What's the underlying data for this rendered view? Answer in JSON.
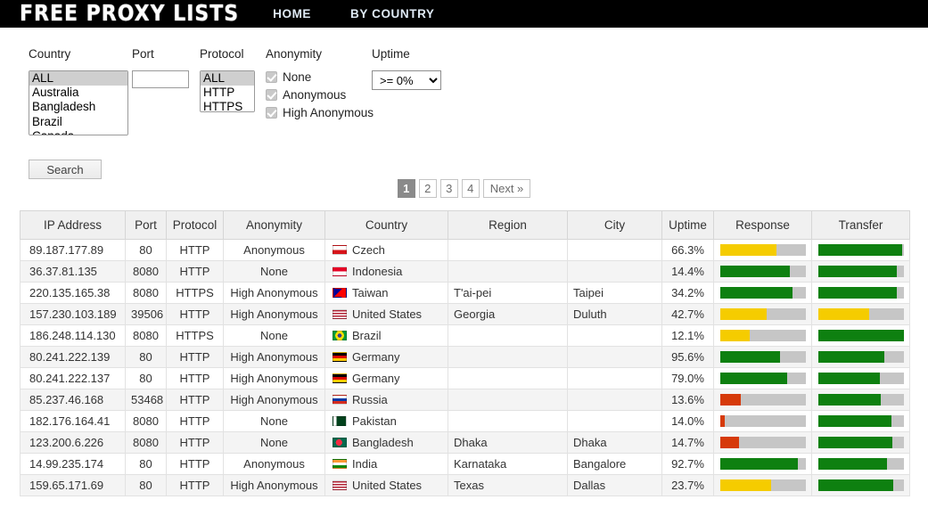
{
  "header": {
    "logo": "FREE PROXY LISTS",
    "nav": [
      {
        "label": "HOME"
      },
      {
        "label": "BY COUNTRY"
      }
    ]
  },
  "filters": {
    "country": {
      "label": "Country",
      "selected": "ALL",
      "options": [
        "ALL",
        "Australia",
        "Bangladesh",
        "Brazil",
        "Canada"
      ]
    },
    "port": {
      "label": "Port",
      "value": "",
      "placeholder": ""
    },
    "protocol": {
      "label": "Protocol",
      "selected": "ALL",
      "options": [
        "ALL",
        "HTTP",
        "HTTPS"
      ]
    },
    "anonymity": {
      "label": "Anonymity",
      "items": [
        {
          "label": "None",
          "checked": true
        },
        {
          "label": "Anonymous",
          "checked": true
        },
        {
          "label": "High Anonymous",
          "checked": true
        }
      ]
    },
    "uptime": {
      "label": "Uptime",
      "selected": ">= 0%",
      "options": [
        ">= 0%"
      ]
    },
    "search_label": "Search"
  },
  "pagination": {
    "pages": [
      "1",
      "2",
      "3",
      "4"
    ],
    "active": "1",
    "next_label": "Next »"
  },
  "table": {
    "columns": [
      "IP Address",
      "Port",
      "Protocol",
      "Anonymity",
      "Country",
      "Region",
      "City",
      "Uptime",
      "Response",
      "Transfer"
    ],
    "rows": [
      {
        "ip": "89.187.177.89",
        "port": "80",
        "protocol": "HTTP",
        "anonymity": "Anonymous",
        "country": "Czech",
        "flag": "cz",
        "region": "",
        "city": "",
        "uptime": "66.3%",
        "response": 66,
        "response_color": "#f5cc00",
        "transfer": 98,
        "transfer_color": "#0e8010"
      },
      {
        "ip": "36.37.81.135",
        "port": "8080",
        "protocol": "HTTP",
        "anonymity": "None",
        "country": "Indonesia",
        "flag": "id",
        "region": "",
        "city": "",
        "uptime": "14.4%",
        "response": 82,
        "response_color": "#0e8010",
        "transfer": 92,
        "transfer_color": "#0e8010"
      },
      {
        "ip": "220.135.165.38",
        "port": "8080",
        "protocol": "HTTPS",
        "anonymity": "High Anonymous",
        "country": "Taiwan",
        "flag": "tw",
        "region": "T'ai-pei",
        "city": "Taipei",
        "uptime": "34.2%",
        "response": 85,
        "response_color": "#0e8010",
        "transfer": 92,
        "transfer_color": "#0e8010"
      },
      {
        "ip": "157.230.103.189",
        "port": "39506",
        "protocol": "HTTP",
        "anonymity": "High Anonymous",
        "country": "United States",
        "flag": "us",
        "region": "Georgia",
        "city": "Duluth",
        "uptime": "42.7%",
        "response": 55,
        "response_color": "#f5cc00",
        "transfer": 60,
        "transfer_color": "#f5cc00"
      },
      {
        "ip": "186.248.114.130",
        "port": "8080",
        "protocol": "HTTPS",
        "anonymity": "None",
        "country": "Brazil",
        "flag": "br",
        "region": "",
        "city": "",
        "uptime": "12.1%",
        "response": 35,
        "response_color": "#f5cc00",
        "transfer": 100,
        "transfer_color": "#0e8010"
      },
      {
        "ip": "80.241.222.139",
        "port": "80",
        "protocol": "HTTP",
        "anonymity": "High Anonymous",
        "country": "Germany",
        "flag": "de",
        "region": "",
        "city": "",
        "uptime": "95.6%",
        "response": 70,
        "response_color": "#0e8010",
        "transfer": 78,
        "transfer_color": "#0e8010"
      },
      {
        "ip": "80.241.222.137",
        "port": "80",
        "protocol": "HTTP",
        "anonymity": "High Anonymous",
        "country": "Germany",
        "flag": "de",
        "region": "",
        "city": "",
        "uptime": "79.0%",
        "response": 79,
        "response_color": "#0e8010",
        "transfer": 72,
        "transfer_color": "#0e8010"
      },
      {
        "ip": "85.237.46.168",
        "port": "53468",
        "protocol": "HTTP",
        "anonymity": "High Anonymous",
        "country": "Russia",
        "flag": "ru",
        "region": "",
        "city": "",
        "uptime": "13.6%",
        "response": 24,
        "response_color": "#d63a0a",
        "transfer": 73,
        "transfer_color": "#0e8010"
      },
      {
        "ip": "182.176.164.41",
        "port": "8080",
        "protocol": "HTTP",
        "anonymity": "None",
        "country": "Pakistan",
        "flag": "pk",
        "region": "",
        "city": "",
        "uptime": "14.0%",
        "response": 6,
        "response_color": "#d63a0a",
        "transfer": 86,
        "transfer_color": "#0e8010"
      },
      {
        "ip": "123.200.6.226",
        "port": "8080",
        "protocol": "HTTP",
        "anonymity": "None",
        "country": "Bangladesh",
        "flag": "bd",
        "region": "Dhaka",
        "city": "Dhaka",
        "uptime": "14.7%",
        "response": 22,
        "response_color": "#d63a0a",
        "transfer": 87,
        "transfer_color": "#0e8010"
      },
      {
        "ip": "14.99.235.174",
        "port": "80",
        "protocol": "HTTP",
        "anonymity": "Anonymous",
        "country": "India",
        "flag": "in",
        "region": "Karnataka",
        "city": "Bangalore",
        "uptime": "92.7%",
        "response": 91,
        "response_color": "#0e8010",
        "transfer": 81,
        "transfer_color": "#0e8010"
      },
      {
        "ip": "159.65.171.69",
        "port": "80",
        "protocol": "HTTP",
        "anonymity": "High Anonymous",
        "country": "United States",
        "flag": "us",
        "region": "Texas",
        "city": "Dallas",
        "uptime": "23.7%",
        "response": 60,
        "response_color": "#f5cc00",
        "transfer": 88,
        "transfer_color": "#0e8010"
      }
    ]
  },
  "colors": {
    "good": "#0e8010",
    "warn": "#f5cc00",
    "bad": "#d63a0a",
    "track": "#c6c6c6",
    "header_bg": "#000000"
  }
}
